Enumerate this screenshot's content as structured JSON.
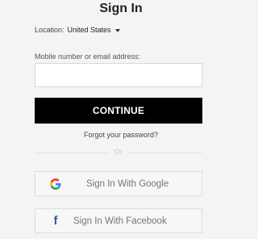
{
  "header": {
    "title": "Sign In"
  },
  "location": {
    "label": "Location:",
    "value": "United States",
    "icon": "chevron-down-icon"
  },
  "login_field": {
    "label": "Mobile number or email address:",
    "value": "",
    "placeholder": ""
  },
  "actions": {
    "continue_label": "CONTINUE",
    "forgot_label": "Forgot your password?",
    "divider_label": "Or"
  },
  "social": {
    "google_label": "Sign In With Google",
    "google_icon": "google-icon",
    "facebook_label": "Sign In With Facebook",
    "facebook_icon": "facebook-icon"
  },
  "colors": {
    "background": "#f4f4f4",
    "primary_button": "#000000",
    "facebook_blue": "#3b5998",
    "google_blue": "#4285F4",
    "google_red": "#EA4335",
    "google_yellow": "#FBBC05",
    "google_green": "#34A853"
  }
}
